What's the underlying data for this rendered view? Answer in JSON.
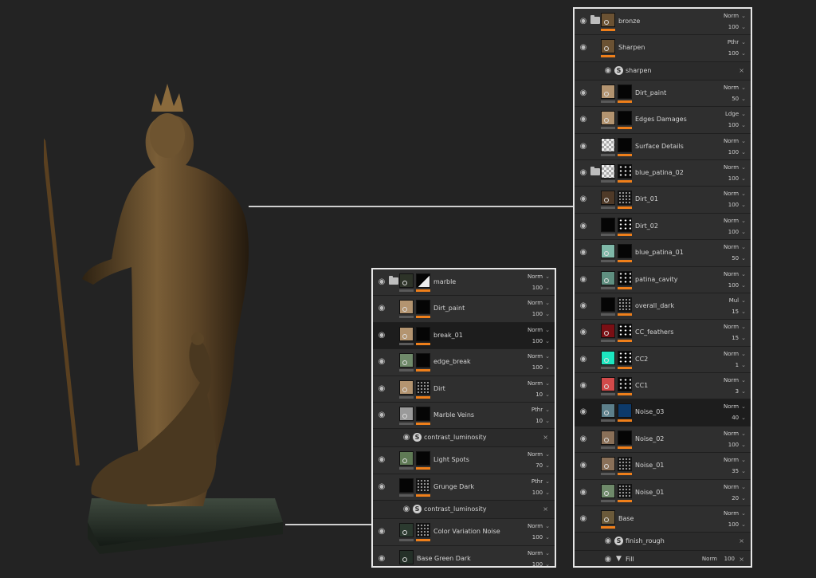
{
  "colors": {
    "background": "#232323",
    "accent": "#ef7f1a",
    "panel_border": "#e6e6e6"
  },
  "right_panel": {
    "layers": [
      {
        "type": "layer",
        "folder": true,
        "name": "bronze",
        "blend": "Norm",
        "opacity": "100",
        "thumb": "#6b5233"
      },
      {
        "type": "layer",
        "name": "Sharpen",
        "blend": "Pthr",
        "opacity": "100",
        "thumb": "#6b5233"
      },
      {
        "type": "effect",
        "name": "sharpen"
      },
      {
        "type": "layer",
        "name": "Dirt_paint",
        "blend": "Norm",
        "opacity": "50",
        "thumb": "#b39470",
        "mask": "dark"
      },
      {
        "type": "layer",
        "name": "Edges Damages",
        "blend": "Ldge",
        "opacity": "100",
        "thumb": "#b39470",
        "mask": "dark"
      },
      {
        "type": "layer",
        "name": "Surface Details",
        "blend": "Norm",
        "opacity": "100",
        "thumb": "checker",
        "mask": "dark"
      },
      {
        "type": "layer",
        "folder": true,
        "name": "blue_patina_02",
        "blend": "Norm",
        "opacity": "100",
        "thumb": "checker",
        "mask": "speck"
      },
      {
        "type": "layer",
        "name": "Dirt_01",
        "blend": "Norm",
        "opacity": "100",
        "thumb": "#4f3a28",
        "mask": "noise"
      },
      {
        "type": "layer",
        "name": "Dirt_02",
        "blend": "Norm",
        "opacity": "100",
        "thumb": "#050505",
        "mask": "speck"
      },
      {
        "type": "layer",
        "name": "blue_patina_01",
        "blend": "Norm",
        "opacity": "50",
        "thumb": "#7fb8a8",
        "mask": "dark"
      },
      {
        "type": "layer",
        "name": "patina_cavity",
        "blend": "Norm",
        "opacity": "100",
        "thumb": "#5f8f80",
        "mask": "speck"
      },
      {
        "type": "layer",
        "name": "overall_dark",
        "blend": "Mul",
        "opacity": "15",
        "thumb": "#050505",
        "mask": "noise"
      },
      {
        "type": "layer",
        "name": "CC_feathers",
        "blend": "Norm",
        "opacity": "15",
        "thumb": "#7a0f14",
        "mask": "speck"
      },
      {
        "type": "layer",
        "name": "CC2",
        "blend": "Norm",
        "opacity": "1",
        "thumb": "#1de6c0",
        "mask": "speck"
      },
      {
        "type": "layer",
        "name": "CC1",
        "blend": "Norm",
        "opacity": "3",
        "thumb": "#d24a4a",
        "mask": "speck"
      },
      {
        "type": "layer",
        "name": "Noise_03",
        "blend": "Norm",
        "opacity": "40",
        "thumb": "#5c7f8a",
        "mask": "#0d3a6a",
        "selected": true
      },
      {
        "type": "layer",
        "name": "Noise_02",
        "blend": "Norm",
        "opacity": "100",
        "thumb": "#8a7058",
        "mask": "dark"
      },
      {
        "type": "layer",
        "name": "Noise_01",
        "blend": "Norm",
        "opacity": "35",
        "thumb": "#8a7058",
        "mask": "noise"
      },
      {
        "type": "layer",
        "name": "Noise_01",
        "blend": "Norm",
        "opacity": "20",
        "thumb": "#6f8a6a",
        "mask": "noise"
      },
      {
        "type": "layer",
        "name": "Base",
        "blend": "Norm",
        "opacity": "100",
        "thumb": "#6b5a3a"
      },
      {
        "type": "effect",
        "name": "finish_rough"
      },
      {
        "type": "fill",
        "name": "Fill",
        "blend": "Norm",
        "opacity": "100"
      }
    ]
  },
  "left_panel": {
    "layers": [
      {
        "type": "layer",
        "folder": true,
        "name": "marble",
        "blend": "Norm",
        "opacity": "100",
        "thumb": "#2d3328",
        "mask": "corner"
      },
      {
        "type": "layer",
        "name": "Dirt_paint",
        "blend": "Norm",
        "opacity": "100",
        "thumb": "#b39470",
        "mask": "dark"
      },
      {
        "type": "layer",
        "name": "break_01",
        "blend": "Norm",
        "opacity": "100",
        "thumb": "#b39470",
        "mask": "dark",
        "selected": true
      },
      {
        "type": "layer",
        "name": "edge_break",
        "blend": "Norm",
        "opacity": "100",
        "thumb": "#6f8a6a",
        "mask": "dark"
      },
      {
        "type": "layer",
        "name": "Dirt",
        "blend": "Norm",
        "opacity": "10",
        "thumb": "#b39470",
        "mask": "noise"
      },
      {
        "type": "layer",
        "name": "Marble Veins",
        "blend": "Pthr",
        "opacity": "10",
        "thumb": "#9a9a9a",
        "mask": "dark"
      },
      {
        "type": "effect",
        "name": "contrast_luminosity"
      },
      {
        "type": "layer",
        "name": "Light Spots",
        "blend": "Norm",
        "opacity": "70",
        "thumb": "#5f7a55",
        "mask": "dark"
      },
      {
        "type": "layer",
        "name": "Grunge Dark",
        "blend": "Pthr",
        "opacity": "100",
        "thumb": "#050505",
        "mask": "noise"
      },
      {
        "type": "effect",
        "name": "contrast_luminosity"
      },
      {
        "type": "layer",
        "name": "Color Variation Noise",
        "blend": "Norm",
        "opacity": "100",
        "thumb": "#2b3a2f",
        "mask": "noise"
      },
      {
        "type": "layer",
        "name": "Base Green Dark",
        "blend": "Norm",
        "opacity": "100",
        "thumb": "#243028"
      }
    ]
  }
}
